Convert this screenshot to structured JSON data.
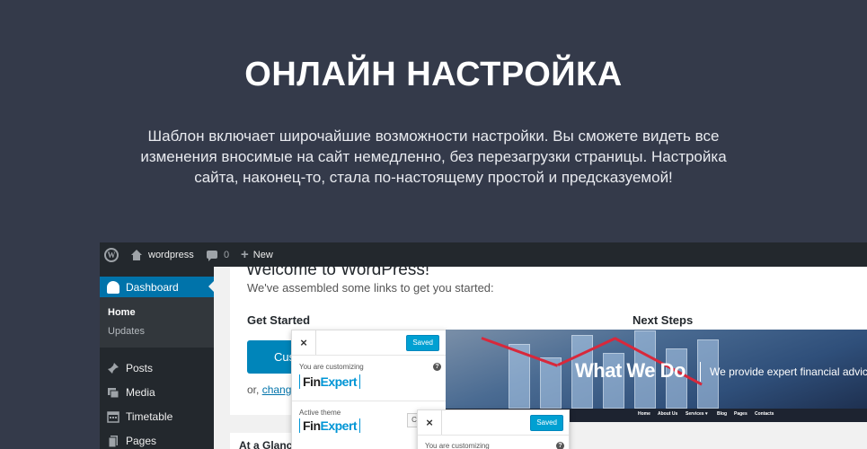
{
  "hero": {
    "title": "ОНЛАЙН НАСТРОЙКА",
    "line1": "Шаблон включает широчайшие возможности настройки. Вы сможете видеть все",
    "line2": "изменения вносимые на сайт немедленно, без перезагрузки страницы. Настройка",
    "line3": "сайта, наконец-то, стала по-настоящему простой и предсказуемой!"
  },
  "adminbar": {
    "site": "wordpress",
    "comments": "0",
    "new": "New"
  },
  "sidebar": {
    "dashboard": "Dashboard",
    "home": "Home",
    "updates": "Updates",
    "posts": "Posts",
    "media": "Media",
    "timetable": "Timetable",
    "pages": "Pages"
  },
  "welcome": {
    "title": "Welcome to WordPress!",
    "subtitle": "We've assembled some links to get you started:",
    "get_started": "Get Started",
    "next_steps": "Next Steps",
    "button": "Cust",
    "or_text": "or, ",
    "or_link": "change"
  },
  "glance": "At a Glance",
  "customizer": {
    "close": "×",
    "saved": "Saved",
    "you_are": "You are customizing",
    "help": "?",
    "brand_a": "Fin",
    "brand_b": "Expert",
    "active_theme": "Active theme",
    "change_btn": "C"
  },
  "preview": {
    "headline": "What We Do",
    "tagline": "We provide expert financial advice fo",
    "nav": [
      "Home",
      "About Us",
      "Services ▾",
      "Blog",
      "Pages",
      "Contacts"
    ]
  }
}
